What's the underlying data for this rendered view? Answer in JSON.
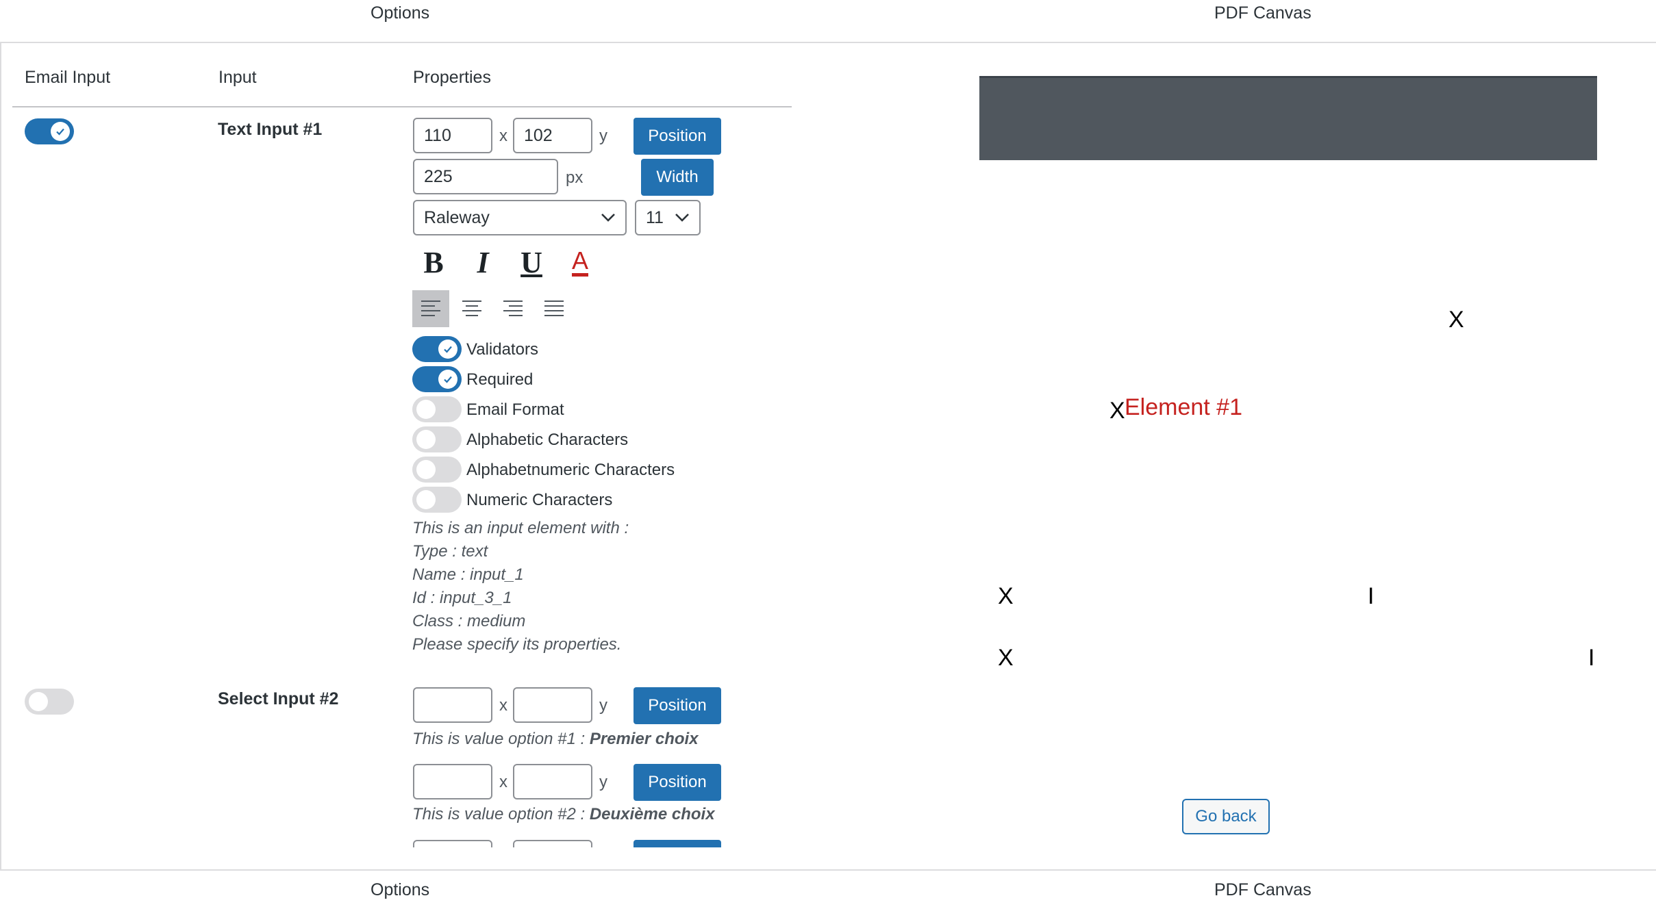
{
  "header": {
    "options_label": "Options",
    "canvas_label": "PDF Canvas"
  },
  "footer": {
    "options_label": "Options",
    "canvas_label": "PDF Canvas"
  },
  "columns": {
    "email": "Email Input",
    "input": "Input",
    "properties": "Properties"
  },
  "rows": [
    {
      "title": "Text Input #1",
      "email_enabled": true,
      "x_value": "110",
      "y_value": "102",
      "x_sep": "x",
      "y_sep": "y",
      "position_label": "Position",
      "width_value": "225",
      "width_unit": "px",
      "width_label": "Width",
      "font_family": "Raleway",
      "font_size": "11",
      "format": {
        "bold": "B",
        "italic": "I",
        "underline": "U",
        "color": "A",
        "color_hex": "#c5221f"
      },
      "toggles": [
        {
          "label": "Validators",
          "on": true
        },
        {
          "label": "Required",
          "on": true
        },
        {
          "label": "Email Format",
          "on": false
        },
        {
          "label": "Alphabetic Characters",
          "on": false
        },
        {
          "label": "Alphabetnumeric Characters",
          "on": false
        },
        {
          "label": "Numeric Characters",
          "on": false
        }
      ],
      "description": [
        "This is an input element with :",
        "Type : text",
        "Name : input_1",
        "Id : input_3_1",
        "Class : medium",
        "Please specify its properties."
      ]
    },
    {
      "title": "Select Input #2",
      "email_enabled": false,
      "options": [
        {
          "x_value": "",
          "y_value": "",
          "position_label": "Position",
          "desc_prefix": "This is value option #1 : ",
          "desc_value": "Premier choix"
        },
        {
          "x_value": "",
          "y_value": "",
          "position_label": "Position",
          "desc_prefix": "This is value option #2 : ",
          "desc_value": "Deuxième choix"
        }
      ]
    }
  ],
  "canvas": {
    "marks": [
      "X",
      "X",
      "X",
      "I",
      "X",
      "I"
    ],
    "element_label": "Element #1",
    "go_back": "Go back"
  },
  "colors": {
    "accent": "#2271b1",
    "toggle_off": "#dcdcde",
    "pdf_bar": "#50575e",
    "element_text": "#c5221f"
  }
}
